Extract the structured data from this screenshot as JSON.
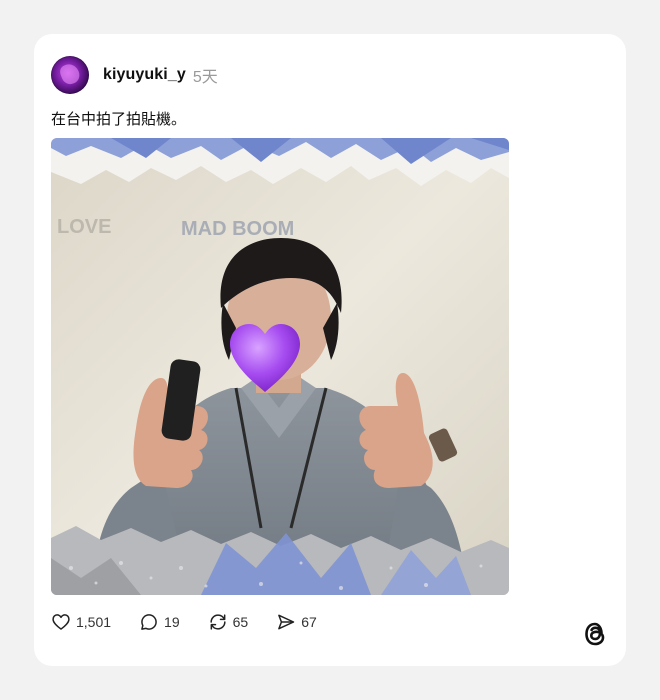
{
  "post": {
    "username": "kiyuyuki_y",
    "time_ago": "5天",
    "text": "在台中拍了拍貼機。",
    "photo": {
      "frame_text_left": "LOVE",
      "frame_text_right": "MAD BOOM",
      "emoji": "💜"
    }
  },
  "actions": {
    "like_count": "1,501",
    "reply_count": "19",
    "repost_count": "65",
    "share_count": "67"
  },
  "icons": {
    "avatar": "avatar-image",
    "like": "heart-icon",
    "reply": "comment-bubble-icon",
    "repost": "repost-icon",
    "share": "send-icon",
    "brand": "threads-logo-icon"
  },
  "colors": {
    "background": "#f2f2f2",
    "card": "#ffffff",
    "text": "#101010",
    "muted": "#9a9a9a"
  }
}
